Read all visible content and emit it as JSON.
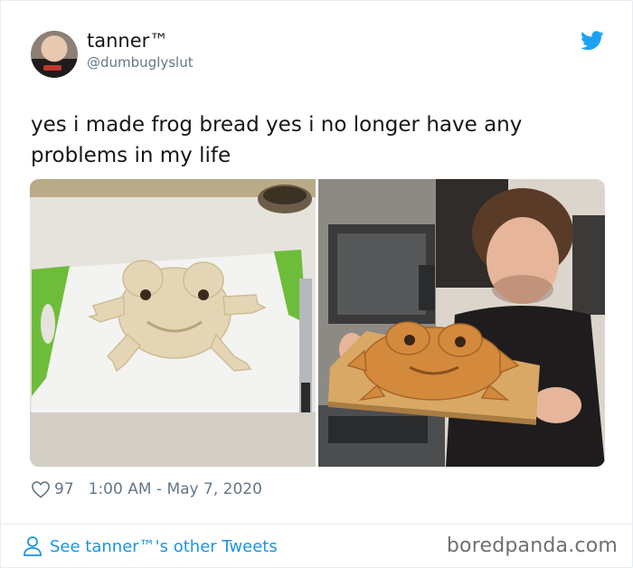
{
  "author": {
    "name": "tanner™",
    "handle": "@dumbuglyslut"
  },
  "tweet": {
    "text": "yes i made frog bread yes i no longer have any problems in my life"
  },
  "stats": {
    "likes": "97",
    "timestamp": "1:00 AM - May 7, 2020"
  },
  "footer": {
    "link_text": "See tanner™'s other Tweets",
    "watermark": "boredpanda.com"
  },
  "icons": {
    "brand": "twitter-bird-icon",
    "like": "heart-icon",
    "profile": "user-icon"
  },
  "colors": {
    "twitter_blue": "#1da1f2",
    "link_blue": "#1b95e0",
    "secondary_text": "#657786"
  }
}
